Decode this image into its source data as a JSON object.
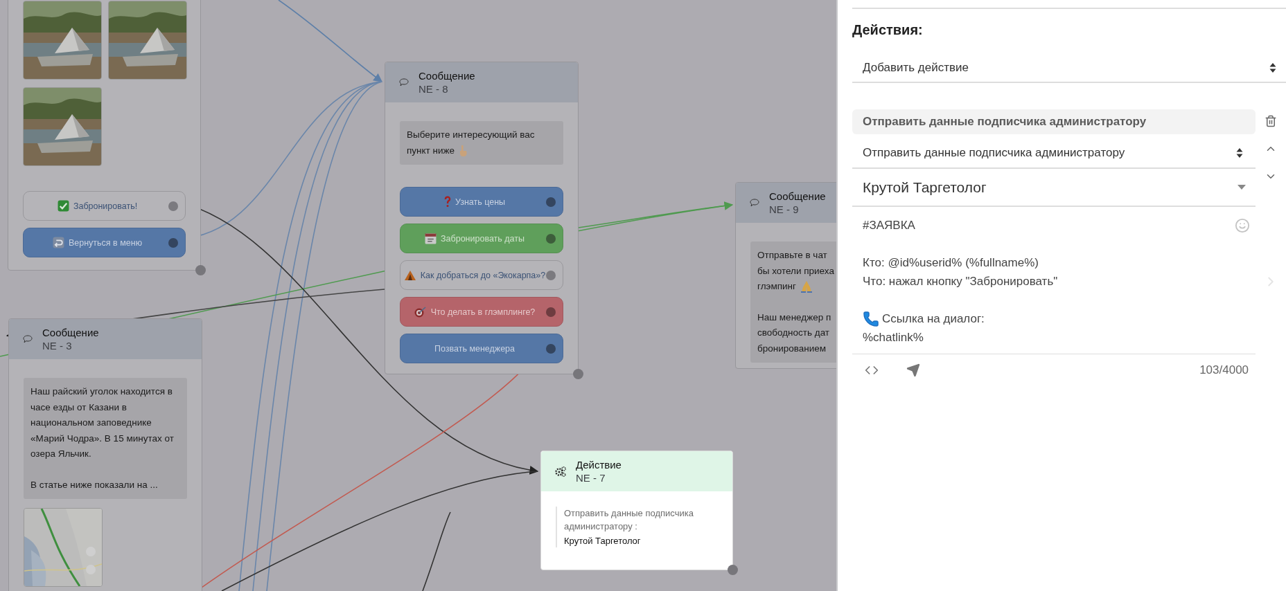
{
  "canvas": {
    "nodes": [
      {
        "kind": "message",
        "pictures": [
          {
            "kind": "picture"
          },
          {
            "kind": "picture"
          },
          {
            "kind": "picture"
          }
        ],
        "buttons": [
          {
            "label": "Забронировать!",
            "kind": "outline"
          },
          {
            "label": "Вернуться в меню",
            "kind": "blue"
          }
        ]
      },
      {
        "kind": "message",
        "title": "Сообщение",
        "code": "NE - 8",
        "paragraphs": [
          {
            "text": "Выберите интересующий вас",
            "tail": "пункт ниже"
          }
        ],
        "buttons": [
          {
            "label": "Узнать цены",
            "kind": "blue"
          },
          {
            "label": "Забронировать даты",
            "kind": "green"
          },
          {
            "label": "Как добраться до «Экокарпа»?",
            "kind": "outline"
          },
          {
            "label": "Что делать в глэмплинге?",
            "kind": "red"
          },
          {
            "label": "Позвать менеджера",
            "kind": "blue"
          }
        ]
      },
      {
        "kind": "message",
        "title": "Сообщение",
        "code": "NE - 9",
        "paragraphs": [
          {
            "text": "Отправьте в чат\nбы хотели приеха",
            "tail": "глэмпинг"
          },
          {
            "text": "Наш менеджер п\nсвободность дат\nбронированием"
          }
        ]
      },
      {
        "kind": "message",
        "title": "Сообщение",
        "code": "NE - 3",
        "paragraphs": [
          {
            "text": "Наш райский уголок находится в часе езды от Казани в национальном заповеднике «Марий Чодра». В 15 минутах от озера Яльчик."
          },
          {
            "text": "В статье ниже показали на ..."
          }
        ],
        "pictures": [
          {
            "kind": "picture"
          }
        ]
      },
      {
        "kind": "action",
        "title": "Действие",
        "code": "NE - 7",
        "action_text": "Отправить данные подписчика администратору :",
        "target": "Крутой Таргетолог"
      }
    ]
  },
  "panel": {
    "heading": "Действия:",
    "add_select": {
      "value": "Добавить действие"
    },
    "action": {
      "label": "Отправить данные подписчика администратору",
      "type_select": {
        "value": "Отправить данные подписчика администратору"
      },
      "recipient": {
        "value": "Крутой Таргетолог"
      },
      "message": {
        "paragraphs": [
          {
            "lines": [
              "#ЗАЯВКА"
            ]
          },
          {
            "lines": [
              "Кто: @id%userid% (%fullname%)",
              "Что: нажал кнопку \"Забронировать\""
            ]
          },
          {
            "lines": [
              "Ссылка на диалог:",
              "%chatlink%"
            ]
          }
        ]
      },
      "counter": "103/4000"
    }
  }
}
